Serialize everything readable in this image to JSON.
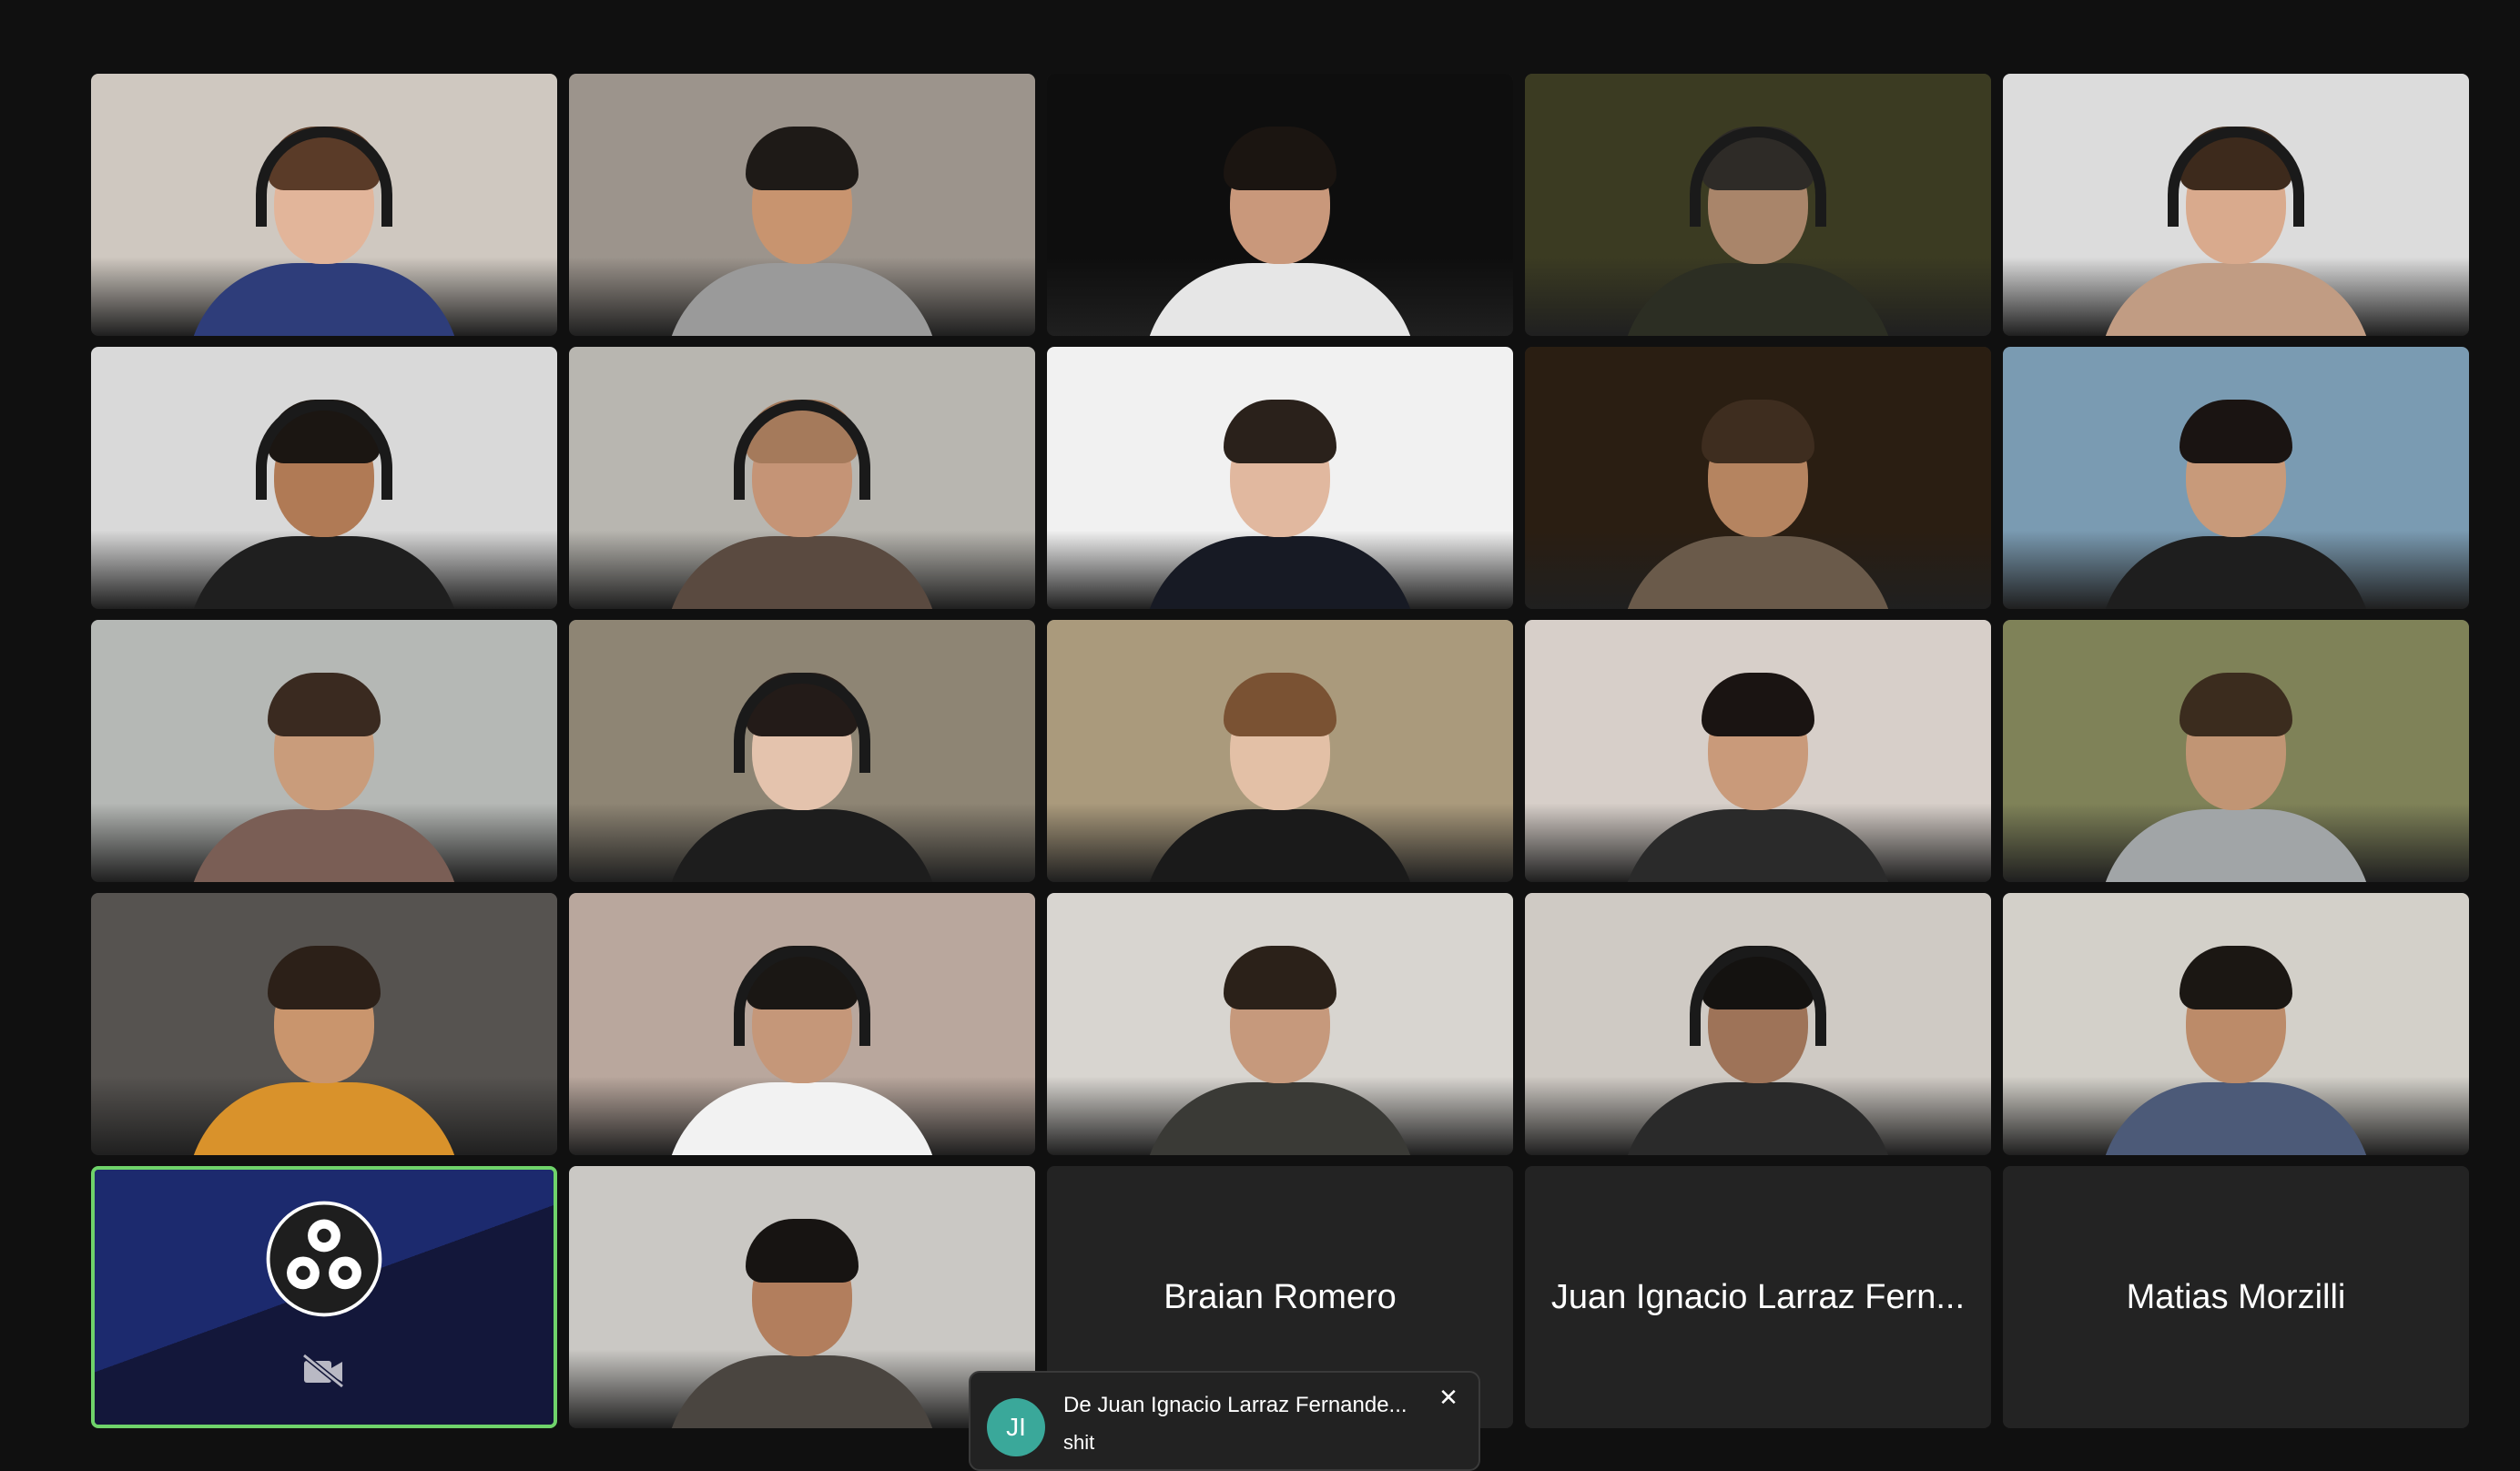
{
  "participants": [
    {
      "kind": "video",
      "bg": "#cfc8c0",
      "skin": "#e2b59a",
      "hair": "#5a3b28",
      "shirt": "#2e3d7a",
      "headset": true
    },
    {
      "kind": "video",
      "bg": "#9c948c",
      "skin": "#c8946f",
      "hair": "#1e1a17",
      "shirt": "#9a9a9a",
      "headset": false
    },
    {
      "kind": "video",
      "bg": "#0e0e0e",
      "skin": "#c9987b",
      "hair": "#1b1511",
      "shirt": "#e6e6e6",
      "headset": false
    },
    {
      "kind": "video",
      "bg": "#3b3b22",
      "skin": "#a9856a",
      "hair": "#2e2b27",
      "shirt": "#2c2e23",
      "headset": true
    },
    {
      "kind": "video",
      "bg": "#dcdcdc",
      "skin": "#d9aa8d",
      "hair": "#3d2a1c",
      "shirt": "#c19c83",
      "headset": true
    },
    {
      "kind": "video",
      "bg": "#d9d9d9",
      "skin": "#b07a55",
      "hair": "#1b1612",
      "shirt": "#1f1f1f",
      "headset": true
    },
    {
      "kind": "video",
      "bg": "#b8b6b0",
      "skin": "#c59476",
      "hair": "#a57a5b",
      "shirt": "#5a4a40",
      "headset": true
    },
    {
      "kind": "video",
      "bg": "#f1f1f1",
      "skin": "#e1b89f",
      "hair": "#2a211b",
      "shirt": "#171a24",
      "headset": false
    },
    {
      "kind": "video",
      "bg": "#2a1e12",
      "skin": "#b58460",
      "hair": "#3e2d1f",
      "shirt": "#6a5a4a",
      "headset": false
    },
    {
      "kind": "video",
      "bg": "#7a9bb2",
      "skin": "#c89a7a",
      "hair": "#1a1412",
      "shirt": "#1e1e1e",
      "headset": false
    },
    {
      "kind": "video",
      "bg": "#b5b8b5",
      "skin": "#c99c7b",
      "hair": "#3a2a20",
      "shirt": "#7a5e55",
      "headset": false
    },
    {
      "kind": "video",
      "bg": "#8e8574",
      "skin": "#e4c3ad",
      "hair": "#231b18",
      "shirt": "#1d1d1d",
      "headset": true
    },
    {
      "kind": "video",
      "bg": "#aa9a7c",
      "skin": "#e3c0a6",
      "hair": "#7a5233",
      "shirt": "#1a1a1a",
      "headset": false
    },
    {
      "kind": "video",
      "bg": "#d7cfc9",
      "skin": "#c99a7a",
      "hair": "#1a1412",
      "shirt": "#2a2a2a",
      "headset": false
    },
    {
      "kind": "video",
      "bg": "#7f8258",
      "skin": "#c19574",
      "hair": "#3b2c1e",
      "shirt": "#a1a5a7",
      "headset": false
    },
    {
      "kind": "video",
      "bg": "#565350",
      "skin": "#c9956d",
      "hair": "#2c2018",
      "shirt": "#d9922b",
      "headset": false
    },
    {
      "kind": "video",
      "bg": "#b9a79d",
      "skin": "#c59779",
      "hair": "#1a1714",
      "shirt": "#f2f2f2",
      "headset": true
    },
    {
      "kind": "video",
      "bg": "#d8d5d0",
      "skin": "#c6997c",
      "hair": "#2b2119",
      "shirt": "#3a3a36",
      "headset": false
    },
    {
      "kind": "video",
      "bg": "#cfcac4",
      "skin": "#9e7358",
      "hair": "#141210",
      "shirt": "#2a2a2a",
      "headset": true
    },
    {
      "kind": "video",
      "bg": "#d3d0c9",
      "skin": "#bc8b69",
      "hair": "#1b1713",
      "shirt": "#4c5a78",
      "headset": false
    },
    {
      "kind": "obs"
    },
    {
      "kind": "video",
      "bg": "#cac8c4",
      "skin": "#b27e5d",
      "hair": "#171412",
      "shirt": "#4a4540",
      "headset": false
    },
    {
      "kind": "name",
      "name": "Braian Romero"
    },
    {
      "kind": "name",
      "name": "Juan Ignacio Larraz Fern..."
    },
    {
      "kind": "name",
      "name": "Matias Morzilli"
    }
  ],
  "icons": {
    "obs_logo": "obs-logo-icon",
    "camera_off": "camera-off-icon",
    "close": "close-icon"
  },
  "chat_toast": {
    "initials": "JI",
    "from": "De Juan Ignacio Larraz Fernande...",
    "message": "shit",
    "close_glyph": "✕",
    "avatar_color": "#3aa89a"
  }
}
